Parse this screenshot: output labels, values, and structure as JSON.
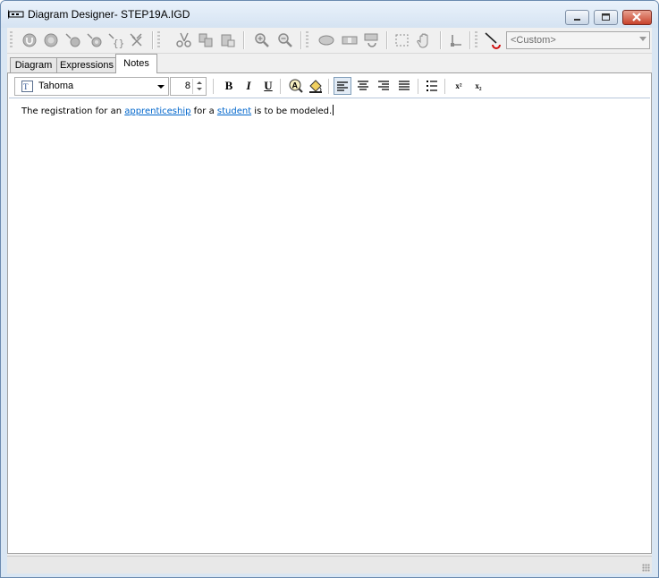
{
  "window": {
    "title": "Diagram Designer- STEP19A.IGD"
  },
  "toolbar": {
    "style_combo": {
      "value": "<Custom>"
    },
    "buttons": [
      "undo-icon",
      "redo-icon",
      "node-undo-icon",
      "node-redo-icon",
      "brace-icon",
      "scissors-icon",
      "cut-icon",
      "copy-icon",
      "paste-icon",
      "zoom-in-icon",
      "zoom-out-icon",
      "shape-icon",
      "toggle-icon",
      "link-icon",
      "select-icon",
      "hand-icon",
      "anchor-icon",
      "pen-icon"
    ]
  },
  "tabs": [
    {
      "label": "Diagram"
    },
    {
      "label": "Expressions"
    },
    {
      "label": "Notes",
      "active": true
    }
  ],
  "format_bar": {
    "font_name": "Tahoma",
    "font_size": "8",
    "bold_label": "B",
    "italic_label": "I",
    "underline_label": "U",
    "superscript_label": "x²",
    "subscript_label": "x₂",
    "alignment": "left"
  },
  "note": {
    "part1": "The registration for an ",
    "link1": "apprenticeship",
    "part2": " for a ",
    "link2": "student",
    "part3": " is to be modeled."
  },
  "colors": {
    "link": "#0066cc",
    "titlebar": "#d5e3f2"
  }
}
